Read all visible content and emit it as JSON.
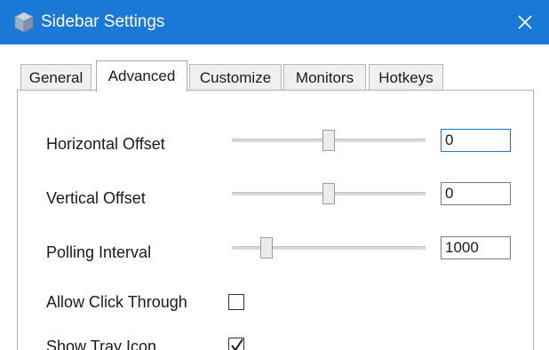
{
  "window": {
    "title": "Sidebar Settings",
    "accent": "#1a78d6"
  },
  "tabs": [
    {
      "label": "General",
      "active": false
    },
    {
      "label": "Advanced",
      "active": true
    },
    {
      "label": "Customize",
      "active": false
    },
    {
      "label": "Monitors",
      "active": false
    },
    {
      "label": "Hotkeys",
      "active": false
    }
  ],
  "advanced": {
    "horizontal_offset": {
      "label": "Horizontal Offset",
      "value": "0",
      "slider_fraction": 0.5
    },
    "vertical_offset": {
      "label": "Vertical Offset",
      "value": "0",
      "slider_fraction": 0.5
    },
    "polling_interval": {
      "label": "Polling Interval",
      "value": "1000",
      "slider_fraction": 0.18
    },
    "allow_click_through": {
      "label": "Allow Click Through",
      "checked": false
    },
    "show_tray_icon": {
      "label": "Show Tray Icon",
      "checked": true
    }
  },
  "icons": {
    "app": "sidebar-cube-icon",
    "close": "close-icon",
    "check": "checkmark-icon"
  }
}
